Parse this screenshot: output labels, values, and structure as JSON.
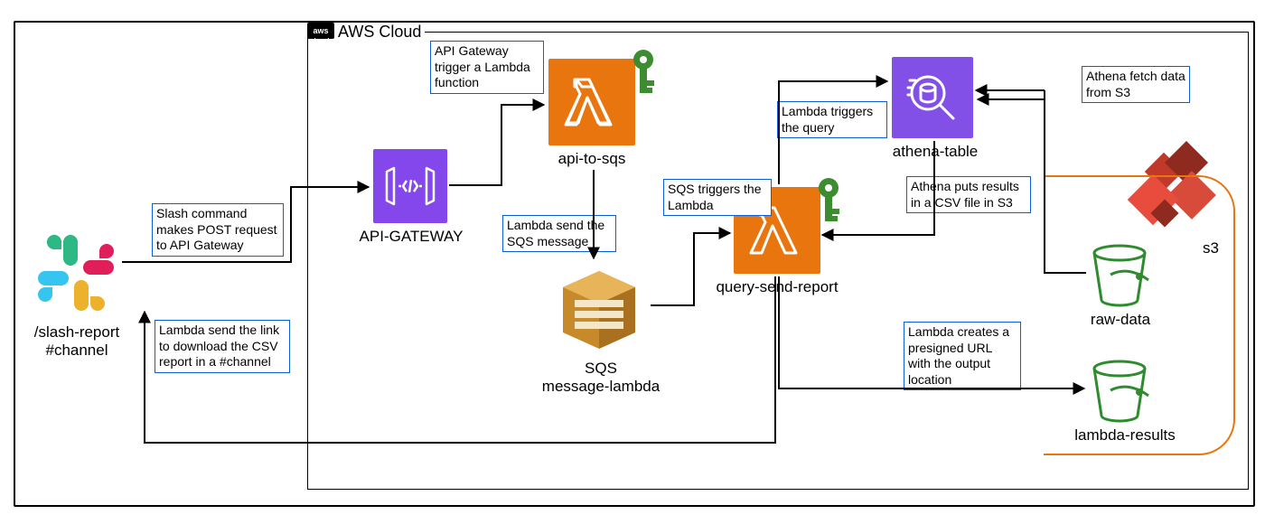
{
  "cloud_label": "AWS Cloud",
  "slack": {
    "command": "/slash-report",
    "channel": "#channel"
  },
  "nodes": {
    "api_gateway": "API-GATEWAY",
    "lambda1": "api-to-sqs",
    "sqs_line1": "SQS",
    "sqs_line2": "message-lambda",
    "lambda2": "query-send-report",
    "athena": "athena-table",
    "bucket_raw": "raw-data",
    "bucket_results": "lambda-results",
    "s3": "s3"
  },
  "callouts": {
    "slash_post": "Slash command makes POST request to API Gateway",
    "link_back": "Lambda send the link to download the CSV report in a #channel",
    "gw_trigger": "API Gateway trigger a Lambda function",
    "lambda_sqs": "Lambda send the SQS message",
    "sqs_trigger": "SQS triggers the Lambda",
    "lambda_query": "Lambda triggers the query",
    "athena_csv": "Athena puts results in a CSV file in S3",
    "athena_fetch": "Athena fetch data from S3",
    "presigned": "Lambda creates a presigned URL with  the output location"
  }
}
